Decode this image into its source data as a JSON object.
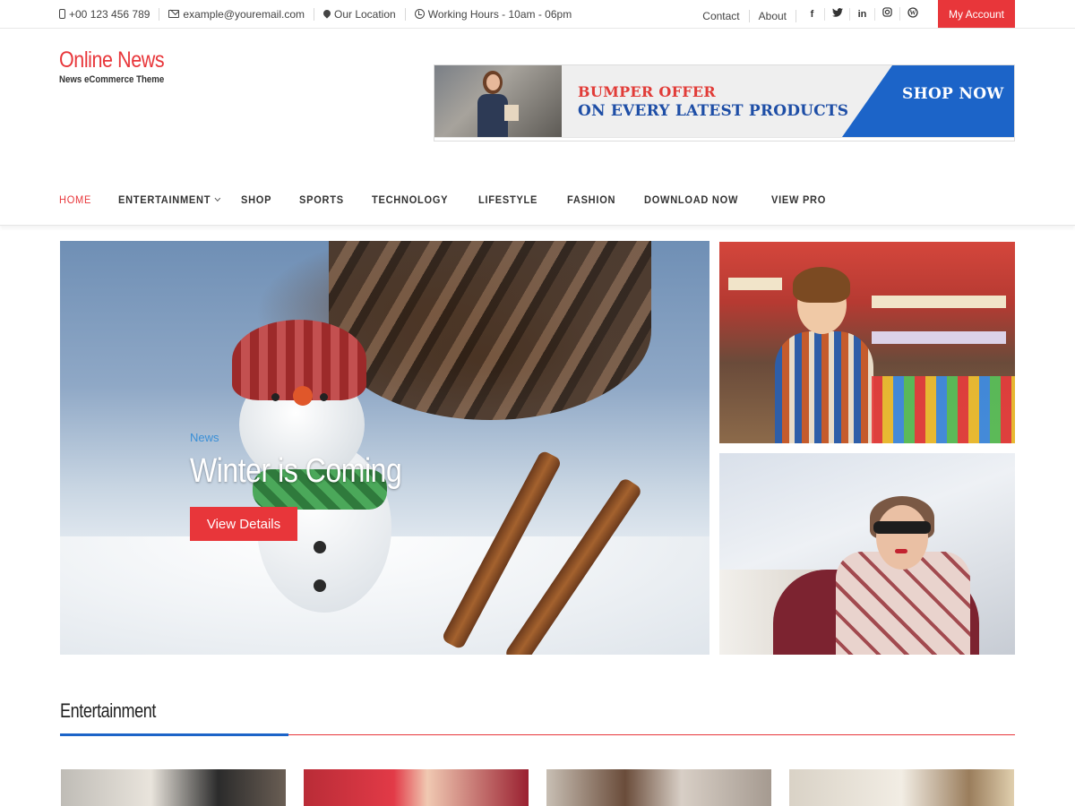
{
  "topbar": {
    "phone": "+00 123 456 789",
    "email": "example@youremail.com",
    "location": "Our Location",
    "hours": "Working Hours - 10am - 06pm",
    "links": [
      "Contact",
      "About"
    ],
    "social": [
      {
        "icon": "facebook-icon",
        "glyph": "f"
      },
      {
        "icon": "twitter-icon",
        "glyph": "t"
      },
      {
        "icon": "linkedin-icon",
        "glyph": "in"
      },
      {
        "icon": "instagram-icon",
        "glyph": "◎"
      },
      {
        "icon": "wordpress-icon",
        "glyph": "W"
      }
    ],
    "account_label": "My Account"
  },
  "header": {
    "title": "Online News",
    "tagline": "News eCommerce Theme",
    "banner": {
      "line1": "BUMPER OFFER",
      "line2": "ON EVERY LATEST PRODUCTS",
      "cta": "SHOP NOW"
    }
  },
  "nav": {
    "items": [
      {
        "label": "HOME",
        "active": true
      },
      {
        "label": "ENTERTAINMENT",
        "dropdown": true
      },
      {
        "label": "SHOP"
      },
      {
        "label": "SPORTS"
      },
      {
        "label": "TECHNOLOGY"
      },
      {
        "label": "LIFESTYLE"
      },
      {
        "label": "FASHION"
      },
      {
        "label": "DOWNLOAD NOW"
      },
      {
        "label": "VIEW PRO"
      }
    ]
  },
  "hero": {
    "category": "News",
    "title": "Winter is Coming",
    "button": "View Details"
  },
  "section": {
    "title": "Entertainment"
  },
  "colors": {
    "accent": "#e8363a",
    "blue": "#1c64c8",
    "category_blue": "#3a8fd6"
  }
}
